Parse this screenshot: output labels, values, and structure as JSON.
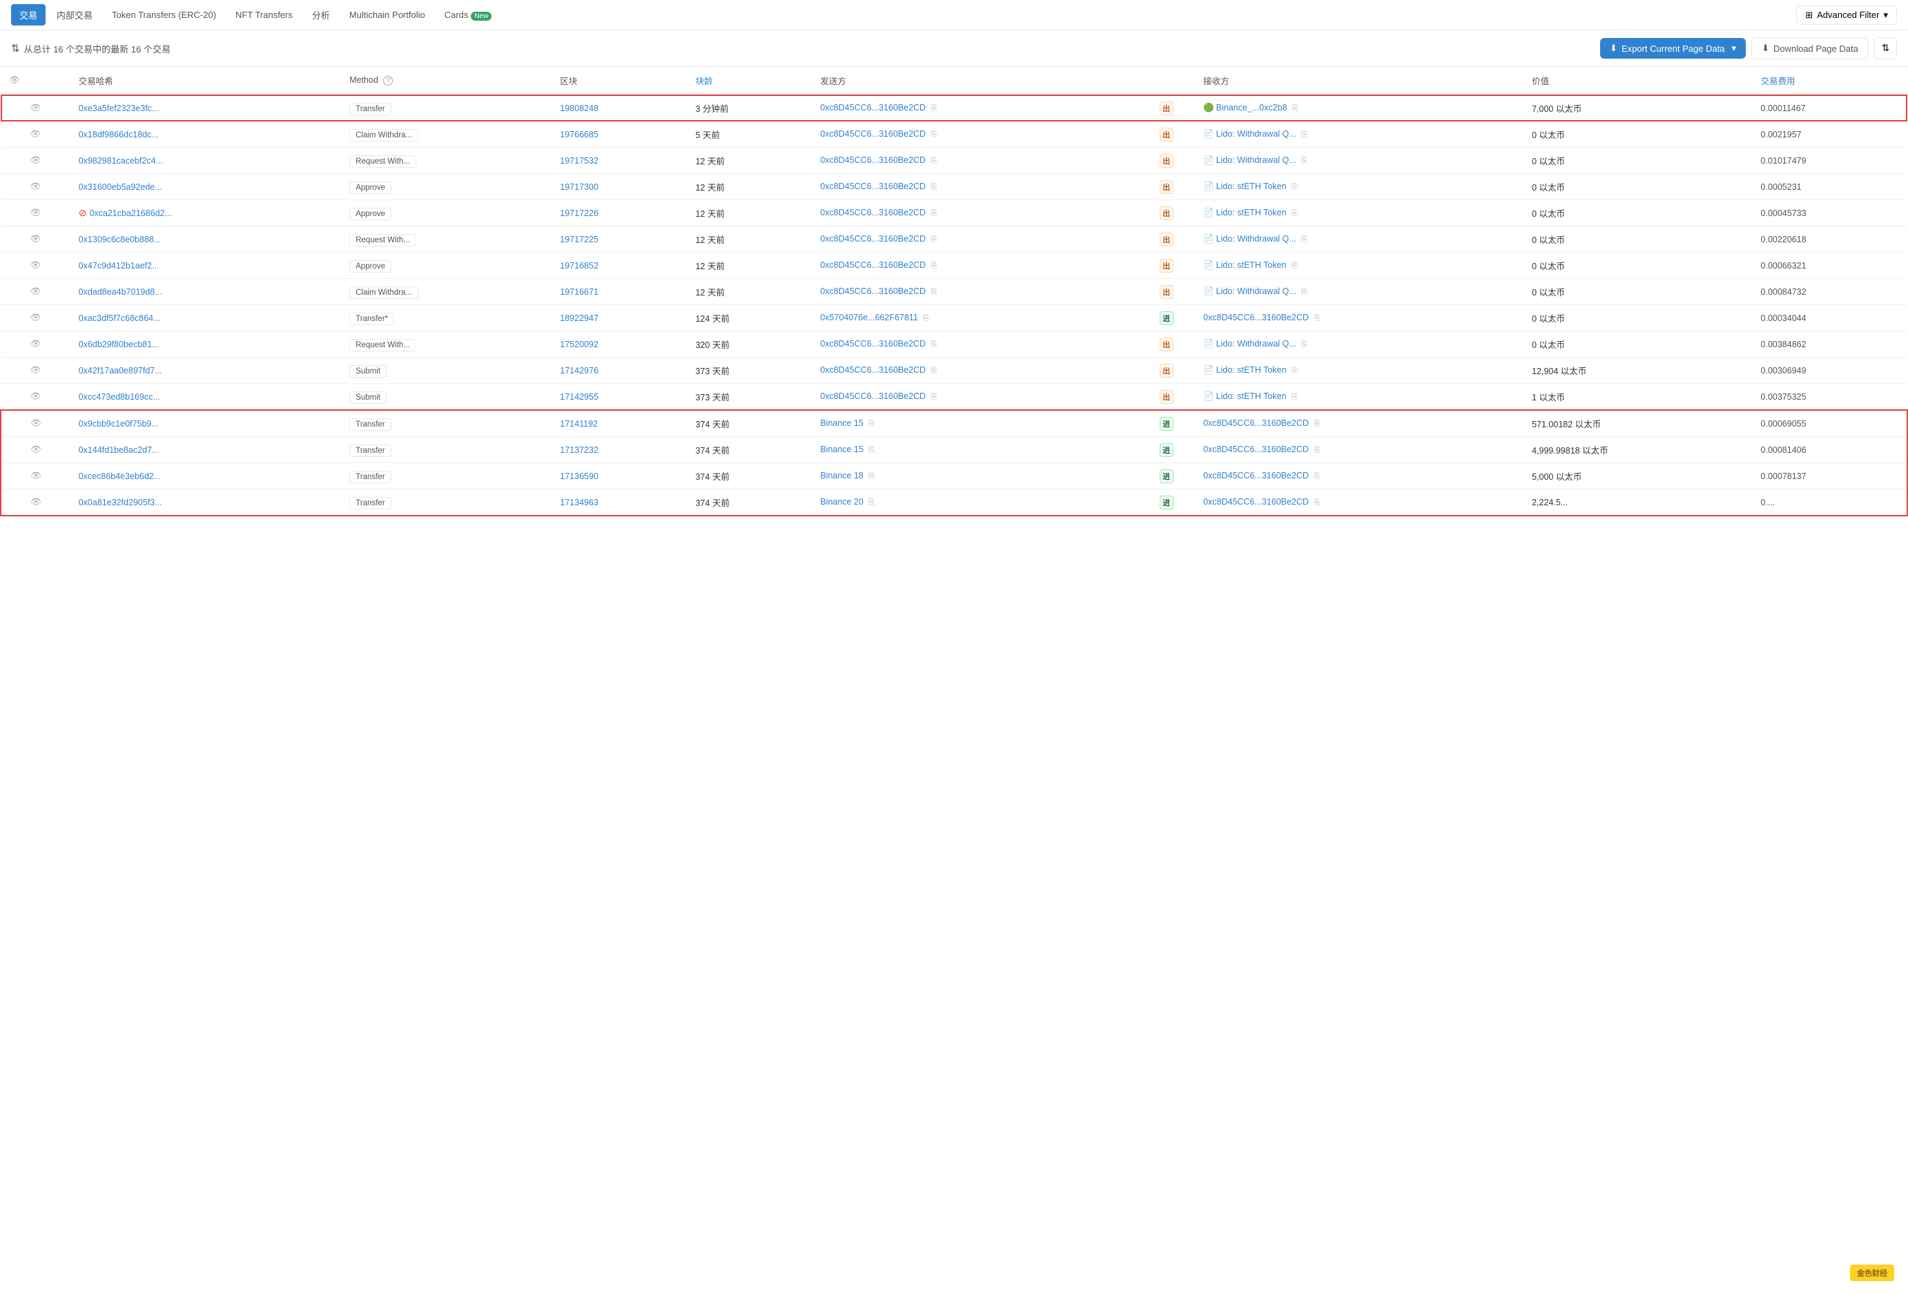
{
  "nav": {
    "tabs": [
      {
        "id": "transactions",
        "label": "交易",
        "active": true
      },
      {
        "id": "internal",
        "label": "内部交易",
        "active": false
      },
      {
        "id": "token-transfers",
        "label": "Token Transfers (ERC-20)",
        "active": false
      },
      {
        "id": "nft-transfers",
        "label": "NFT Transfers",
        "active": false
      },
      {
        "id": "analytics",
        "label": "分析",
        "active": false
      },
      {
        "id": "multichain",
        "label": "Multichain Portfolio",
        "active": false
      },
      {
        "id": "cards",
        "label": "Cards",
        "active": false,
        "badge": "New"
      }
    ],
    "advanced_filter": "Advanced Filter"
  },
  "toolbar": {
    "summary": "从总计 16 个交易中的最新 16 个交易",
    "sort_icon": "⇅",
    "export_label": "Export Current Page Data",
    "download_label": "Download Page Data"
  },
  "table": {
    "columns": [
      "",
      "交易哈希",
      "Method",
      "区块",
      "块龄",
      "发送方",
      "",
      "接收方",
      "价值",
      "交易费用"
    ],
    "rows": [
      {
        "id": "row1",
        "highlight_single": true,
        "eye": true,
        "error": false,
        "tx_hash": "0xe3a5fef2323e3fc...",
        "method": "Transfer",
        "block": "19808248",
        "age": "3 分钟前",
        "from": "0xc8D45CC6...3160Be2CD",
        "dir": "out",
        "to_icon": "🟢",
        "to": "Binance_...0xc2b8",
        "value": "7,000 以太币",
        "fee": "0.00011467"
      },
      {
        "id": "row2",
        "highlight_single": false,
        "eye": true,
        "error": false,
        "tx_hash": "0x18df9866dc18dc...",
        "method": "Claim Withdra...",
        "block": "19766685",
        "age": "5 天前",
        "from": "0xc8D45CC6...3160Be2CD",
        "dir": "out",
        "to_icon": "📄",
        "to": "Lido: Withdrawal Q...",
        "value": "0 以太币",
        "fee": "0.0021957"
      },
      {
        "id": "row3",
        "highlight_single": false,
        "eye": true,
        "error": false,
        "tx_hash": "0x982981cacebf2c4...",
        "method": "Request With...",
        "block": "19717532",
        "age": "12 天前",
        "from": "0xc8D45CC6...3160Be2CD",
        "dir": "out",
        "to_icon": "📄",
        "to": "Lido: Withdrawal Q...",
        "value": "0 以太币",
        "fee": "0.01017479"
      },
      {
        "id": "row4",
        "highlight_single": false,
        "eye": true,
        "error": false,
        "tx_hash": "0x31600eb5a92ede...",
        "method": "Approve",
        "block": "19717300",
        "age": "12 天前",
        "from": "0xc8D45CC6...3160Be2CD",
        "dir": "out",
        "to_icon": "📄",
        "to": "Lido: stETH Token",
        "value": "0 以太币",
        "fee": "0.0005231"
      },
      {
        "id": "row5",
        "highlight_single": false,
        "eye": true,
        "error": true,
        "tx_hash": "0xca21cba21686d2...",
        "method": "Approve",
        "block": "19717226",
        "age": "12 天前",
        "from": "0xc8D45CC6...3160Be2CD",
        "dir": "out",
        "to_icon": "📄",
        "to": "Lido: stETH Token",
        "value": "0 以太币",
        "fee": "0.00045733"
      },
      {
        "id": "row6",
        "highlight_single": false,
        "eye": true,
        "error": false,
        "tx_hash": "0x1309c6c8e0b888...",
        "method": "Request With...",
        "block": "19717225",
        "age": "12 天前",
        "from": "0xc8D45CC6...3160Be2CD",
        "dir": "out",
        "to_icon": "📄",
        "to": "Lido: Withdrawal Q...",
        "value": "0 以太币",
        "fee": "0.00220618"
      },
      {
        "id": "row7",
        "highlight_single": false,
        "eye": true,
        "error": false,
        "tx_hash": "0x47c9d412b1aef2...",
        "method": "Approve",
        "block": "19716852",
        "age": "12 天前",
        "from": "0xc8D45CC6...3160Be2CD",
        "dir": "out",
        "to_icon": "📄",
        "to": "Lido: stETH Token",
        "value": "0 以太币",
        "fee": "0.00066321"
      },
      {
        "id": "row8",
        "highlight_single": false,
        "eye": true,
        "error": false,
        "tx_hash": "0xdad8ea4b7019d8...",
        "method": "Claim Withdra...",
        "block": "19716671",
        "age": "12 天前",
        "from": "0xc8D45CC6...3160Be2CD",
        "dir": "out",
        "to_icon": "📄",
        "to": "Lido: Withdrawal Q...",
        "value": "0 以太币",
        "fee": "0.00084732"
      },
      {
        "id": "row9",
        "highlight_single": false,
        "eye": true,
        "error": false,
        "tx_hash": "0xac3df5f7c68c864...",
        "method": "Transfer*",
        "block": "18922947",
        "age": "124 天前",
        "from": "0x5704076e...662F67811",
        "dir": "in",
        "to_icon": "",
        "to": "0xc8D45CC6...3160Be2CD",
        "value": "0 以太币",
        "fee": "0.00034044"
      },
      {
        "id": "row10",
        "highlight_single": false,
        "eye": true,
        "error": false,
        "tx_hash": "0x6db29f80becb81...",
        "method": "Request With...",
        "block": "17520092",
        "age": "320 天前",
        "from": "0xc8D45CC6...3160Be2CD",
        "dir": "out",
        "to_icon": "📄",
        "to": "Lido: Withdrawal Q...",
        "value": "0 以太币",
        "fee": "0.00384862"
      },
      {
        "id": "row11",
        "highlight_single": false,
        "eye": true,
        "error": false,
        "tx_hash": "0x42f17aa0e897fd7...",
        "method": "Submit",
        "block": "17142976",
        "age": "373 天前",
        "from": "0xc8D45CC6...3160Be2CD",
        "dir": "out",
        "to_icon": "📄",
        "to": "Lido: stETH Token",
        "value": "12,904 以太币",
        "fee": "0.00306949"
      },
      {
        "id": "row12",
        "highlight_single": false,
        "eye": true,
        "error": false,
        "tx_hash": "0xcc473ed8b169cc...",
        "method": "Submit",
        "block": "17142955",
        "age": "373 天前",
        "from": "0xc8D45CC6...3160Be2CD",
        "dir": "out",
        "to_icon": "📄",
        "to": "Lido: stETH Token",
        "value": "1 以太币",
        "fee": "0.00375325"
      },
      {
        "id": "row13",
        "highlight_group": true,
        "group_pos": "top",
        "eye": true,
        "error": false,
        "tx_hash": "0x9cbb9c1e0f75b9...",
        "method": "Transfer",
        "block": "17141192",
        "age": "374 天前",
        "from": "Binance 15",
        "dir": "in",
        "to_icon": "",
        "to": "0xc8D45CC6...3160Be2CD",
        "value": "571.00182 以太币",
        "fee": "0.00069055"
      },
      {
        "id": "row14",
        "highlight_group": true,
        "group_pos": "middle",
        "eye": true,
        "error": false,
        "tx_hash": "0x144fd1be8ac2d7...",
        "method": "Transfer",
        "block": "17137232",
        "age": "374 天前",
        "from": "Binance 15",
        "dir": "in",
        "to_icon": "",
        "to": "0xc8D45CC6...3160Be2CD",
        "value": "4,999.99818 以太币",
        "fee": "0.00081406"
      },
      {
        "id": "row15",
        "highlight_group": true,
        "group_pos": "middle",
        "eye": true,
        "error": false,
        "tx_hash": "0xcec86b4e3eb6d2...",
        "method": "Transfer",
        "block": "17136590",
        "age": "374 天前",
        "from": "Binance 18",
        "dir": "in",
        "to_icon": "",
        "to": "0xc8D45CC6...3160Be2CD",
        "value": "5,000 以太币",
        "fee": "0.00078137"
      },
      {
        "id": "row16",
        "highlight_group": true,
        "group_pos": "bottom",
        "eye": true,
        "error": false,
        "tx_hash": "0x0a81e32fd2905f3...",
        "method": "Transfer",
        "block": "17134963",
        "age": "374 天前",
        "from": "Binance 20",
        "dir": "in",
        "to_icon": "",
        "to": "0xc8D45CC6...3160Be2CD",
        "value": "2,224.5...",
        "fee": "0...."
      }
    ]
  },
  "icons": {
    "eye": "👁",
    "error": "⊘",
    "copy": "⎘",
    "sort": "⇅",
    "filter": "⇅",
    "download": "⬇",
    "export": "⬇",
    "chevron": "▾",
    "info": "?"
  }
}
